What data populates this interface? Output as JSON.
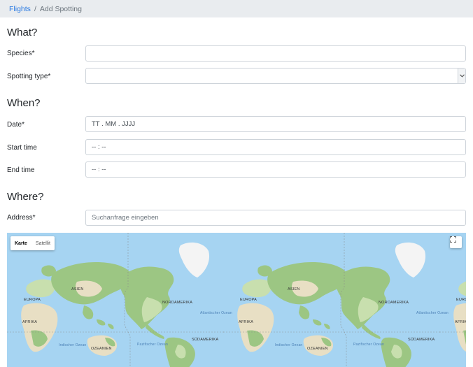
{
  "breadcrumb": {
    "parent": "Flights",
    "separator": "/",
    "current": "Add Spotting"
  },
  "sections": {
    "what": "What?",
    "when": "When?",
    "where": "Where?"
  },
  "fields": {
    "species": {
      "label": "Species*",
      "value": ""
    },
    "spotting_type": {
      "label": "Spotting type*",
      "value": ""
    },
    "date": {
      "label": "Date*",
      "placeholder": "TT . MM . JJJJ"
    },
    "start_time": {
      "label": "Start time",
      "placeholder": "-- : --"
    },
    "end_time": {
      "label": "End time",
      "placeholder": "-- : --"
    },
    "address": {
      "label": "Address*",
      "placeholder": "Suchanfrage eingeben"
    }
  },
  "map": {
    "map_type_options": [
      "Karte",
      "Satellit"
    ],
    "selected_map_type": "Karte",
    "labels": {
      "asien": "ASIEN",
      "europa": "EUROPA",
      "afrika": "AFRIKA",
      "nordamerika": "NORDAMERIKA",
      "suedamerika": "SÜDAMERIKA",
      "ozeanien": "OZEANIEN",
      "atlantic": "Atlantischer Ozean",
      "indian": "Indischer Ozean",
      "pacific": "Pazifischer Ozean"
    },
    "colors": {
      "water": "#a6d4f2",
      "land": "#c8dfae",
      "forest": "#9cc683",
      "desert": "#e8dfc4",
      "ice": "#f4f4f4"
    }
  },
  "icons": {
    "select_arrow": "chevron-down-icon",
    "fullscreen": "fullscreen-icon"
  }
}
